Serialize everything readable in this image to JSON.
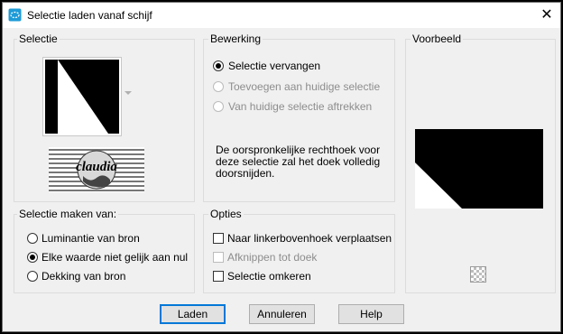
{
  "window": {
    "title": "Selectie laden vanaf schijf"
  },
  "selectie": {
    "label": "Selectie",
    "watermark_text": "claudia"
  },
  "bewerking": {
    "label": "Bewerking",
    "options": [
      "Selectie vervangen",
      "Toevoegen aan huidige selectie",
      "Van huidige selectie aftrekken"
    ],
    "selected_index": 0,
    "description_lines": [
      "De oorspronkelijke rechthoek voor",
      "deze selectie zal het doek volledig",
      "doorsnijden."
    ]
  },
  "voorbeeld": {
    "label": "Voorbeeld"
  },
  "maken": {
    "label": "Selectie maken van:",
    "options": [
      "Luminantie van bron",
      "Elke waarde niet gelijk aan nul",
      "Dekking van bron"
    ],
    "selected_index": 1
  },
  "opties": {
    "label": "Opties",
    "items": [
      {
        "label": "Naar linkerbovenhoek verplaatsen",
        "checked": false,
        "enabled": true
      },
      {
        "label": "Afknippen tot doek",
        "checked": false,
        "enabled": false
      },
      {
        "label": "Selectie omkeren",
        "checked": false,
        "enabled": true
      }
    ]
  },
  "buttons": {
    "load": "Laden",
    "cancel": "Annuleren",
    "help": "Help"
  },
  "icons": {
    "app": "selection-disk-icon",
    "close": "close-icon",
    "dropdown": "dropdown-arrow-icon",
    "background": "transparency-checker-icon"
  },
  "colors": {
    "accent": "#0078d7",
    "app_icon": "#1e9bd7"
  }
}
